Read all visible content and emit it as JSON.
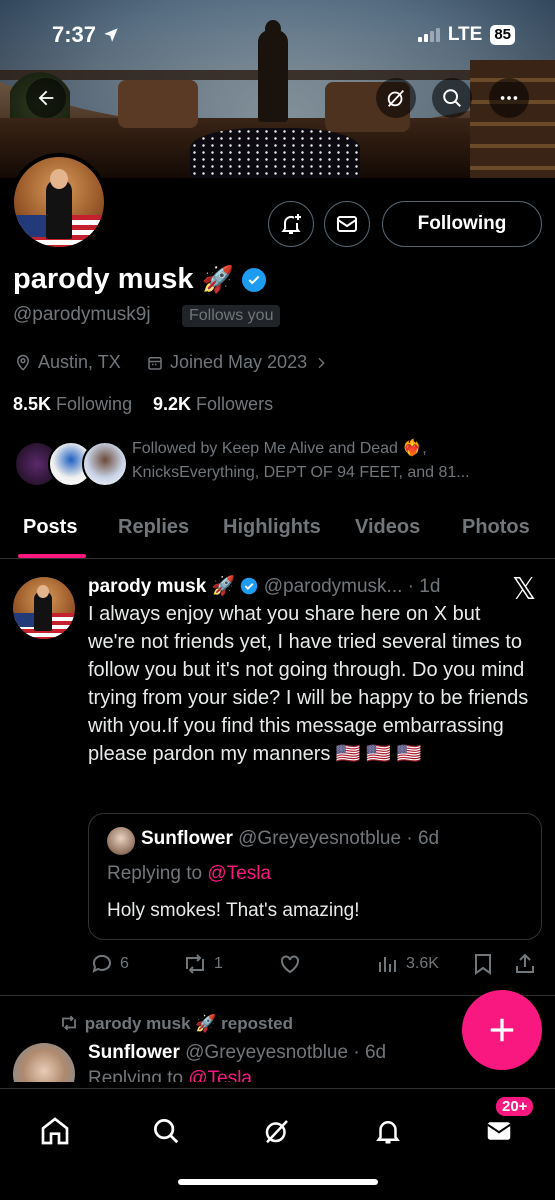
{
  "status_bar": {
    "time": "7:37",
    "network": "LTE",
    "battery": "85"
  },
  "profile": {
    "name": "parody musk",
    "name_emoji": "🚀",
    "handle": "@parodymusk9j",
    "follows_you": "Follows you",
    "location": "Austin, TX",
    "joined": "Joined May 2023",
    "following_count": "8.5K",
    "following_label": "Following",
    "followers_count": "9.2K",
    "followers_label": "Followers",
    "followed_by": "Followed by Keep Me Alive and Dead ❤️‍🔥,",
    "followed_by_2": "KnicksEverything, DEPT OF 94 FEET, and 81..."
  },
  "actions": {
    "following_button": "Following"
  },
  "tabs": [
    {
      "label": "Posts",
      "active": true
    },
    {
      "label": "Replies"
    },
    {
      "label": "Highlights"
    },
    {
      "label": "Videos"
    },
    {
      "label": "Photos"
    }
  ],
  "tweet": {
    "name": "parody musk 🚀",
    "handle_time": "@parodymusk... · 1d",
    "text": "I always enjoy what you share here on X but we're not friends yet, I have tried several times to follow you but it's not going through. Do you mind trying from your side? I will be happy to be friends with you.If you find this message embarrassing please pardon my manners 🇺🇸 🇺🇸 🇺🇸",
    "quote": {
      "name": "Sunflower",
      "handle_time": "@Greyeyesnotblue · 6d",
      "replying_prefix": "Replying to ",
      "replying_to": "@Tesla",
      "text": "Holy smokes! That's amazing!"
    },
    "stats": {
      "replies": "6",
      "reposts": "1",
      "views": "3.6K"
    }
  },
  "tweet2": {
    "context": "parody musk 🚀 reposted",
    "name": "Sunflower",
    "handle_time": "@Greyeyesnotblue · 6d",
    "replying_prefix": "Replying to ",
    "replying_to": "@Tesla"
  },
  "bottom_nav": {
    "messages_badge": "20+"
  },
  "colors": {
    "accent": "#f91880",
    "verified": "#1d9bf0",
    "muted": "#71767b"
  }
}
